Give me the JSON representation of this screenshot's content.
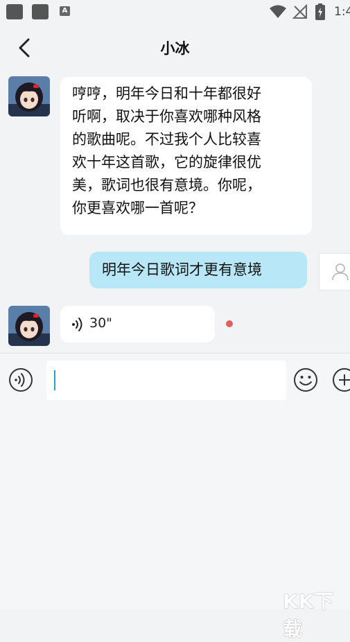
{
  "status_bar": {
    "time": "1:4",
    "a_badge": "A"
  },
  "header": {
    "title": "小冰"
  },
  "messages": [
    {
      "from": "bot",
      "text": "哼哼，明年今日和十年都很好\n听啊，取决于你喜欢哪种风格\n的歌曲呢。不过我个人比较喜\n欢十年这首歌，它的旋律很优\n美，歌词也很有意境。你呢，\n你更喜欢哪一首呢？"
    },
    {
      "from": "user",
      "text": "明年今日歌词才更有意境"
    },
    {
      "from": "bot",
      "type": "voice",
      "duration": "30\""
    }
  ],
  "watermark": "KK下载",
  "colors": {
    "user_bubble": "#b8e8f8",
    "unread_dot": "#e26060",
    "cursor": "#1aa6c9"
  }
}
